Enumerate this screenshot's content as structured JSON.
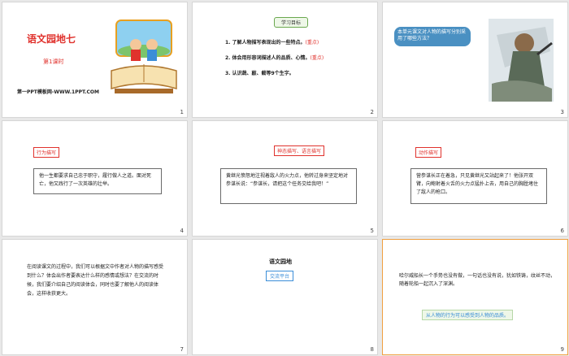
{
  "slides": [
    {
      "num": "1",
      "title": "语文园地七",
      "subtitle": "第1课时",
      "site": "第一PPT模板网-WWW.1PPT.COM"
    },
    {
      "num": "2",
      "badge": "学习目标",
      "goals": [
        {
          "text": "1. 了解人物描写表现出的一些特点。",
          "tag": "(重点)"
        },
        {
          "text": "2. 体会用形容词描述人的品质、心情。",
          "tag": "(重点)"
        },
        {
          "text": "3. 认识蔬、敲、截等9个生字。",
          "tag": ""
        }
      ]
    },
    {
      "num": "3",
      "bubble": "本单元课文对人物的描写分别采用了哪些方法？"
    },
    {
      "num": "4",
      "tag": "行为描写",
      "text": "他一生都要求自己忠于职守，履行做人之道。面对死亡，他又践行了一次英雄的壮举。"
    },
    {
      "num": "5",
      "tag": "神态描写、语言描写",
      "text": "黄继光愤怒地注视着敌人的火力点，他转过身来坚定地对参谋长说：“参谋长，请把这个任务交给我吧！”"
    },
    {
      "num": "6",
      "tag": "动作描写",
      "text": "营参谋长正在着急，只见黄继光又站起来了！他张开双臂，向鲍射着火舌的火力点猛扑上去，用自己的胸膛堵住了敌人的枪口。"
    },
    {
      "num": "7",
      "text": "在阅读课文的过程中，我们可以根据文中作者对人物的描写感受到什么？体会出作者要表达什么样的感情或想法？在交流的时候，我们要介绍自己的阅读体会，同时也要了解他人的阅读体会，这样收获更大。"
    },
    {
      "num": "8",
      "heading": "语文园地",
      "pill": "交流平台"
    },
    {
      "num": "9",
      "text": "哈尔威船长一个手势也没有做，一句话也没有说，犹如铁铸，纹丝不动，随着轮船一起沉入了深渊。",
      "note": "从人物的行为可以感受到人物的品质。"
    }
  ]
}
